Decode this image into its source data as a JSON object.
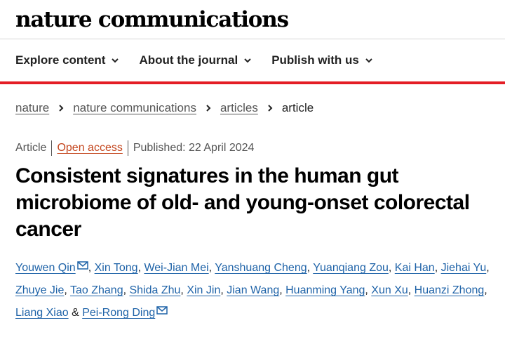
{
  "brand": {
    "logo": "nature communications"
  },
  "nav": [
    {
      "label": "Explore content"
    },
    {
      "label": "About the journal"
    },
    {
      "label": "Publish with us"
    }
  ],
  "breadcrumb": [
    "nature",
    "nature communications",
    "articles",
    "article"
  ],
  "meta": {
    "type": "Article",
    "access": "Open access",
    "published": "Published: 22 April 2024"
  },
  "title": "Consistent signatures in the human gut microbiome of old- and young-onset colorectal cancer",
  "authors": [
    "Youwen Qin",
    "Xin Tong",
    "Wei-Jian Mei",
    "Yanshuang Cheng",
    "Yuanqiang Zou",
    "Kai Han",
    "Jiehai Yu",
    "Zhuye Jie",
    "Tao Zhang",
    "Shida Zhu",
    "Xin Jin",
    "Jian Wang",
    "Huanming Yang",
    "Xun Xu",
    "Huanzi Zhong",
    "Liang Xiao",
    "Pei-Rong Ding"
  ],
  "colors": {
    "accent_red": "#e41e26",
    "link_blue": "#1f63a8",
    "open_access": "#c4461e"
  }
}
